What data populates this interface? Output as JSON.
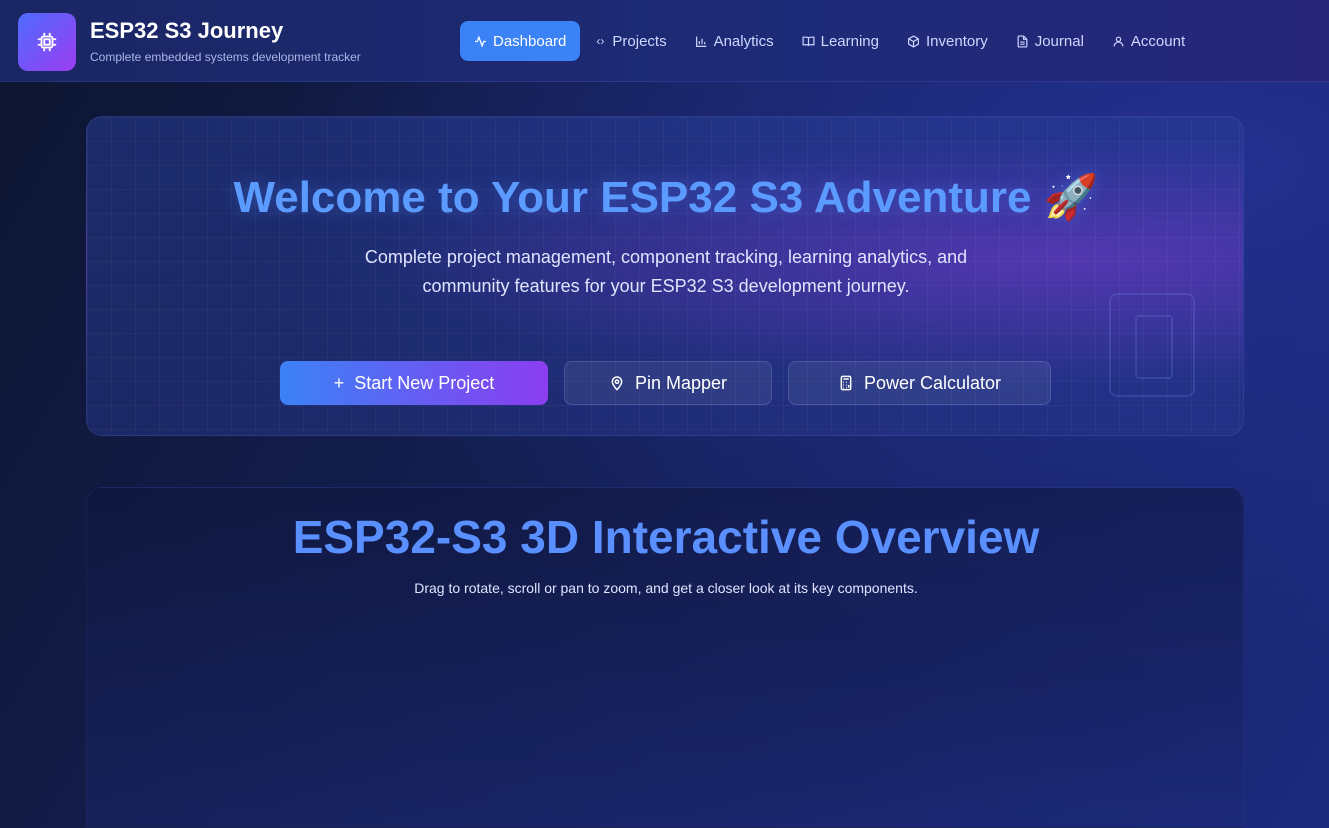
{
  "header": {
    "brand_title": "ESP32 S3 Journey",
    "brand_subtitle": "Complete embedded systems development tracker",
    "logo_icon": "chip-icon",
    "nav": [
      {
        "label": "Dashboard",
        "icon": "activity-icon",
        "active": true
      },
      {
        "label": "Projects",
        "icon": "code-icon",
        "active": false
      },
      {
        "label": "Analytics",
        "icon": "bar-chart-icon",
        "active": false
      },
      {
        "label": "Learning",
        "icon": "book-icon",
        "active": false
      },
      {
        "label": "Inventory",
        "icon": "package-icon",
        "active": false
      },
      {
        "label": "Journal",
        "icon": "file-text-icon",
        "active": false
      },
      {
        "label": "Account",
        "icon": "user-icon",
        "active": false
      }
    ]
  },
  "hero": {
    "title": "Welcome to Your ESP32 S3 Adventure",
    "title_emoji": "🚀",
    "description": "Complete project management, component tracking, learning analytics, and community features for your ESP32 S3 development journey.",
    "buttons": {
      "start_new_project": "Start New Project",
      "pin_mapper": "Pin Mapper",
      "power_calculator": "Power Calculator"
    }
  },
  "overview": {
    "title": "ESP32-S3 3D Interactive Overview",
    "description": "Drag to rotate, scroll or pan to zoom, and get a closer look at its key components."
  },
  "colors": {
    "accent": "#3b82f6",
    "accent_purple": "#8b3df0",
    "heading": "#5b9bff"
  }
}
